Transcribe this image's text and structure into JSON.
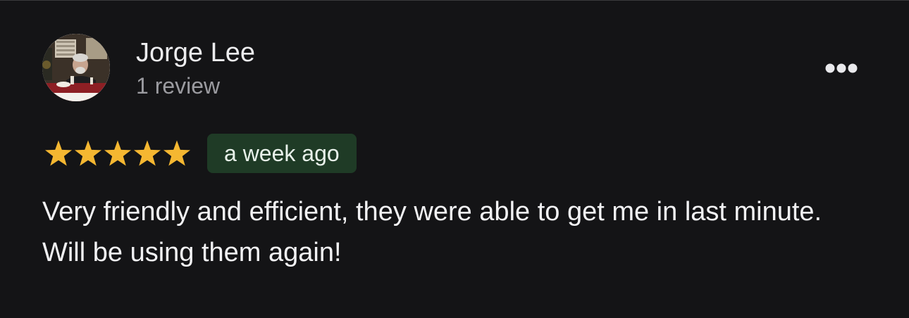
{
  "review": {
    "reviewer": {
      "name": "Jorge Lee",
      "review_count": "1 review"
    },
    "rating": 5,
    "max_rating": 5,
    "time_ago": "a week ago",
    "text": "Very friendly and efficient, they were able to get me in last minute. Will be using them again!"
  },
  "icons": {
    "more": "more-horizontal-icon",
    "star": "star-icon"
  },
  "colors": {
    "background": "#141416",
    "star": "#f5b731",
    "badge_background": "#1f3b26",
    "badge_text": "#e8f1ea",
    "name_text": "#ececee",
    "secondary_text": "#9b9ba0"
  }
}
